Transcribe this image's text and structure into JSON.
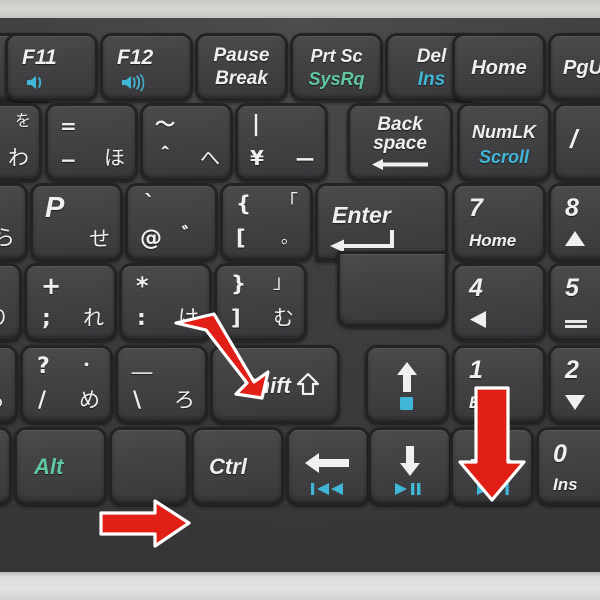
{
  "device": {
    "type": "laptop-keyboard-closeup",
    "layout": "Japanese JIS",
    "bezel_color": "#d6d6d3",
    "deck_color": "#3d3d3f",
    "key_color": "#42424 4",
    "legend_color": "#f2f2f2",
    "accent_cyan": "#3fb7d8",
    "accent_green": "#5fc9a0",
    "annotation_color": "#e21f16"
  },
  "rows": [
    {
      "name": "function-row",
      "keys": [
        {
          "name": "key-f11",
          "main": "F11",
          "icon": "speaker-mute-icon",
          "icon_color": "#3fb7d8"
        },
        {
          "name": "key-f12",
          "main": "F12",
          "icon": "speaker-volume-icon",
          "icon_color": "#3fb7d8"
        },
        {
          "name": "key-pause-break",
          "main": "Pause",
          "sub": "Break",
          "sub_color": "#f4f4f4"
        },
        {
          "name": "key-prtsc-sysrq",
          "main": "Prt Sc",
          "sub": "SysRq",
          "sub_color": "#5fc9a0"
        },
        {
          "name": "key-del-ins",
          "main": "Del",
          "sub": "Ins",
          "sub_color": "#3fb7d8"
        },
        {
          "name": "key-home",
          "main": "Home"
        },
        {
          "name": "key-pgup",
          "main": "PgUp"
        }
      ]
    },
    {
      "name": "number-row",
      "keys": [
        {
          "name": "key-0-wa",
          "tl": "を",
          "bl": ")",
          "br": "わ",
          "partial": true
        },
        {
          "name": "key-equals-ho",
          "tl": "=",
          "bl": "−",
          "br": "ほ"
        },
        {
          "name": "key-tilde-he",
          "tl": "～",
          "bl": "＾",
          "br": "へ"
        },
        {
          "name": "key-pipe-yen",
          "tl": "|",
          "bl": "¥",
          "br": "ー"
        },
        {
          "name": "key-backspace",
          "main": "Back",
          "main2": "space",
          "icon": "arrow-left-long-icon"
        },
        {
          "name": "key-numlk-scroll",
          "main": "NumLK",
          "sub": "Scroll",
          "sub_color": "#3fb7d8"
        },
        {
          "name": "key-numpad-divide",
          "main": "/"
        }
      ]
    },
    {
      "name": "qwerty-row",
      "keys": [
        {
          "name": "key-o-ra",
          "br": "ら",
          "partial": true
        },
        {
          "name": "key-p-se",
          "tl": "P",
          "br": "せ"
        },
        {
          "name": "key-at-dakuten",
          "tl": "`",
          "bl": "@",
          "br": "゛"
        },
        {
          "name": "key-bracket-open",
          "tl": "{",
          "tr": "「",
          "bl": "[",
          "br": "。"
        },
        {
          "name": "key-enter",
          "main": "Enter",
          "icon": "enter-arrow-icon"
        },
        {
          "name": "key-numpad-7",
          "main": "7",
          "sub": "Home"
        },
        {
          "name": "key-numpad-8",
          "main": "8",
          "icon": "triangle-up-icon"
        }
      ]
    },
    {
      "name": "home-row",
      "keys": [
        {
          "name": "key-l-ri",
          "br": "り",
          "partial": true
        },
        {
          "name": "key-semicolon-re",
          "tl": "+",
          "bl": ";",
          "br": "れ"
        },
        {
          "name": "key-colon-ke",
          "tl": "*",
          "bl": ":",
          "br": "け"
        },
        {
          "name": "key-bracket-close",
          "tl": "}",
          "tr": "」",
          "bl": "]",
          "br": "む"
        },
        {
          "name": "key-enter-lower",
          "main": ""
        },
        {
          "name": "key-numpad-4",
          "main": "4",
          "icon": "triangle-left-icon"
        },
        {
          "name": "key-numpad-5",
          "main": "5",
          "icon": "dash-icon"
        }
      ]
    },
    {
      "name": "shift-row",
      "keys": [
        {
          "name": "key-period-ru",
          "tl": ">",
          "tr": "°",
          "bl": ".",
          "br": "る",
          "partial": true
        },
        {
          "name": "key-slash-me",
          "tl": "?",
          "tr": "・",
          "bl": "/",
          "br": "め"
        },
        {
          "name": "key-backslash-ro",
          "tl": "＿",
          "bl": "\\",
          "br": "ろ"
        },
        {
          "name": "key-shift-right",
          "main": "Shift",
          "icon": "shift-up-icon"
        },
        {
          "name": "key-arrow-up",
          "icon": "arrow-up-icon",
          "sub_icon": "stop-square-icon",
          "sub_icon_color": "#3fb7d8"
        },
        {
          "name": "key-numpad-1",
          "main": "1",
          "sub": "End"
        },
        {
          "name": "key-numpad-2",
          "main": "2",
          "icon": "triangle-down-icon"
        }
      ]
    },
    {
      "name": "bottom-row",
      "keys": [
        {
          "name": "key-space",
          "main": "",
          "partial": true
        },
        {
          "name": "key-alt-right",
          "main": "Alt",
          "main_color": "#5fc9a0"
        },
        {
          "name": "key-fn-blank",
          "main": ""
        },
        {
          "name": "key-ctrl-right",
          "main": "Ctrl"
        },
        {
          "name": "key-arrow-left",
          "icon": "arrow-left-icon",
          "sub_icon": "prev-track-icon",
          "sub_icon_color": "#3fb7d8"
        },
        {
          "name": "key-arrow-down",
          "icon": "arrow-down-icon",
          "sub_icon": "play-pause-icon",
          "sub_icon_color": "#3fb7d8"
        },
        {
          "name": "key-arrow-right",
          "icon": "arrow-right-icon",
          "sub_icon": "next-track-icon",
          "sub_icon_color": "#3fb7d8"
        },
        {
          "name": "key-numpad-0",
          "main": "0",
          "sub": "Ins"
        }
      ]
    }
  ],
  "annotations": [
    {
      "name": "annotation-arrow-diagonal",
      "kind": "arrow",
      "direction": "down-right",
      "points_at": "key-shift-right",
      "color": "#e21f16"
    },
    {
      "name": "annotation-arrow-down",
      "kind": "arrow",
      "direction": "down",
      "points_at": "key-arrow-right",
      "color": "#e21f16"
    },
    {
      "name": "annotation-arrow-right",
      "kind": "arrow",
      "direction": "right",
      "points_at": "key-ctrl-right",
      "color": "#e21f16"
    }
  ]
}
